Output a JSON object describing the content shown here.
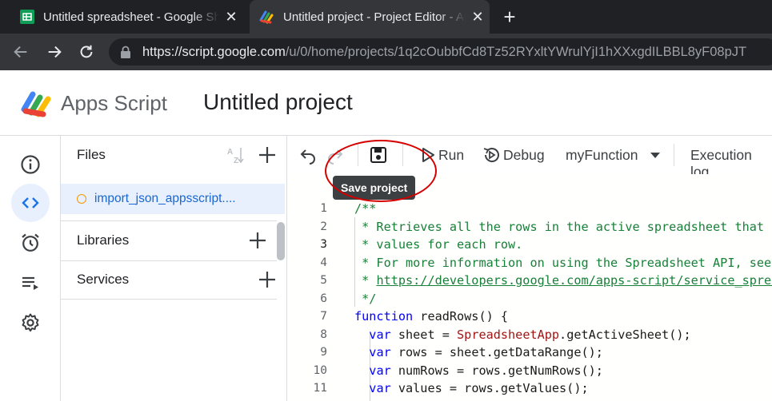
{
  "browser": {
    "tabs": [
      {
        "title": "Untitled spreadsheet - Google Sheets",
        "close": "✕"
      },
      {
        "title": "Untitled project - Project Editor - Apps Script",
        "close": "✕"
      }
    ],
    "new_tab": "+",
    "url_host": "https://script.google.com",
    "url_path": "/u/0/home/projects/1q2cOubbfCd8Tz52RYxltYWrulYjI1hXXxgdILBBL8yF08pJT"
  },
  "app": {
    "name": "Apps Script",
    "project_title": "Untitled project"
  },
  "files_panel": {
    "title": "Files",
    "file_name": "import_json_appsscript....",
    "libraries_label": "Libraries",
    "services_label": "Services"
  },
  "editor_toolbar": {
    "run_label": "Run",
    "debug_label": "Debug",
    "function_select": "myFunction",
    "execution_log_label": "Execution log",
    "tooltip": "Save project"
  },
  "code": {
    "line_numbers": [
      "1",
      "2",
      "3",
      "4",
      "5",
      "6",
      "7",
      "8",
      "9",
      "10",
      "11"
    ],
    "current_line": 3
  },
  "icons": {
    "rail": [
      "info-icon",
      "code-icon",
      "alarm-icon",
      "executions-icon",
      "settings-icon"
    ],
    "toolbar": [
      "undo-icon",
      "redo-icon",
      "save-icon",
      "run-icon",
      "debug-icon"
    ]
  },
  "colors": {
    "accent": "#1a73e8",
    "active_bg": "#e8f0fe",
    "comment": "#188038",
    "keyword": "#0000ff",
    "highlight_ring": "#d50000"
  }
}
